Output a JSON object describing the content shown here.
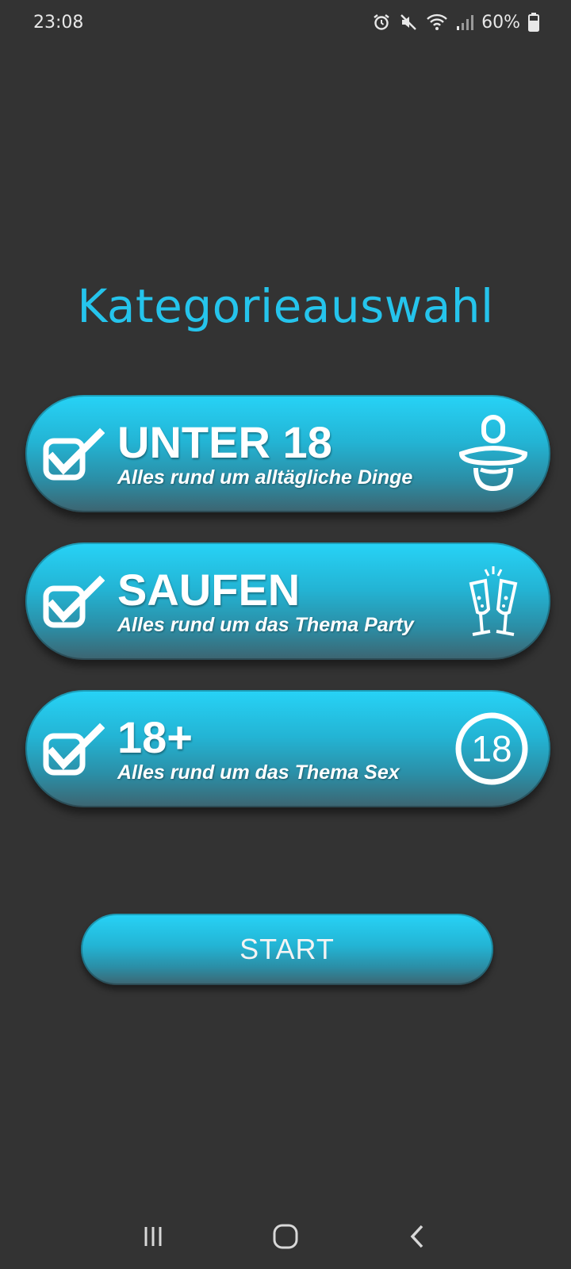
{
  "status_bar": {
    "time": "23:08",
    "battery": "60%",
    "icons": [
      "alarm-icon",
      "mute-icon",
      "wifi-icon",
      "signal-icon",
      "battery-icon"
    ]
  },
  "title": "Kategorieauswahl",
  "categories": [
    {
      "title": "UNTER 18",
      "subtitle": "Alles rund um alltägliche Dinge",
      "checked": true,
      "icon": "pacifier-icon"
    },
    {
      "title": "SAUFEN",
      "subtitle": "Alles rund um das Thema Party",
      "checked": true,
      "icon": "champagne-glasses-icon"
    },
    {
      "title": "18+",
      "subtitle": "Alles rund um das Thema Sex",
      "checked": true,
      "icon": "age-18-icon",
      "icon_text": "18"
    }
  ],
  "start_label": "START",
  "nav": [
    "recents-icon",
    "home-icon",
    "back-icon"
  ],
  "colors": {
    "background": "#333333",
    "accent": "#25c4ec"
  }
}
